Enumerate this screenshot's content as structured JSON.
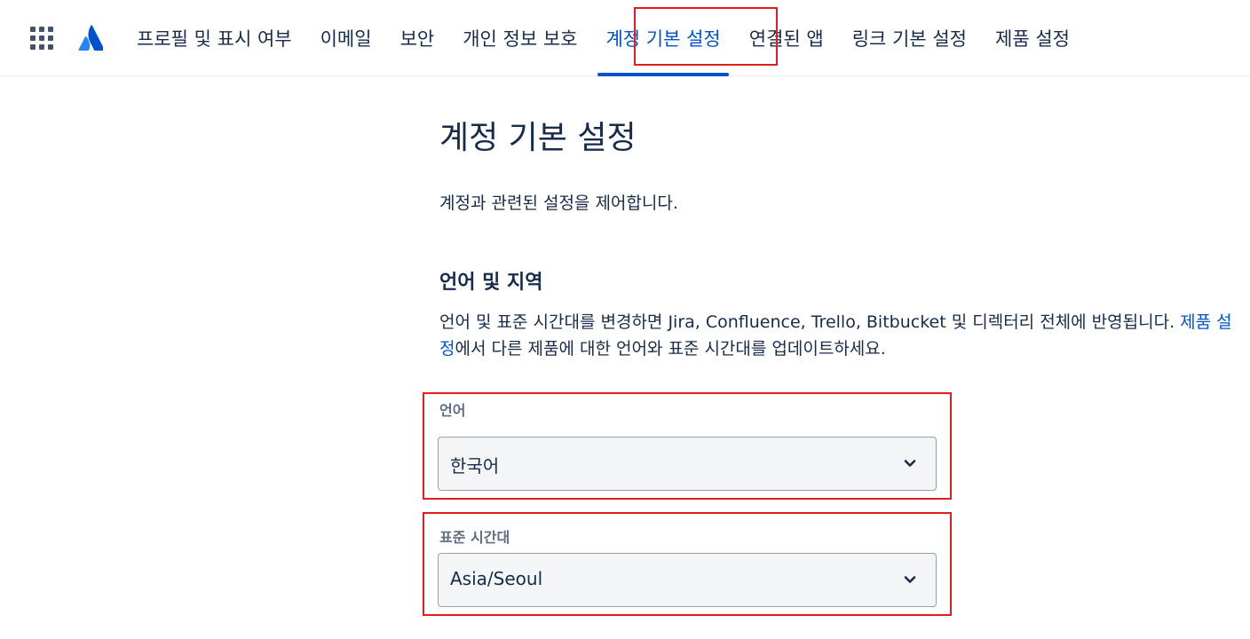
{
  "nav": {
    "tabs": [
      {
        "label": "프로필 및 표시 여부"
      },
      {
        "label": "이메일"
      },
      {
        "label": "보안"
      },
      {
        "label": "개인 정보 보호"
      },
      {
        "label": "계정 기본 설정",
        "active": true
      },
      {
        "label": "연결된 앱"
      },
      {
        "label": "링크 기본 설정"
      },
      {
        "label": "제품 설정"
      }
    ]
  },
  "page": {
    "title": "계정 기본 설정",
    "subtitle": "계정과 관련된 설정을 제어합니다."
  },
  "section": {
    "title": "언어 및 지역",
    "desc_part1": "언어 및 표준 시간대를 변경하면 Jira, Confluence, Trello, Bitbucket 및 디렉터리 전체에 반영됩니다. ",
    "desc_link": "제품 설정",
    "desc_part2": "에서 다른 제품에 대한 언어와 표준 시간대를 업데이트하세요."
  },
  "fields": {
    "language": {
      "label": "언어",
      "value": "한국어"
    },
    "timezone": {
      "label": "표준 시간대",
      "value": "Asia/Seoul"
    }
  },
  "icons": {
    "app_switcher": "app-switcher-icon",
    "logo": "atlassian-logo-icon",
    "chevron": "chevron-down-icon"
  },
  "colors": {
    "accent": "#0052cc",
    "text": "#172b4d",
    "label": "#5e6c84",
    "field_bg": "#f4f5f7",
    "highlight": "#e21d1d"
  }
}
